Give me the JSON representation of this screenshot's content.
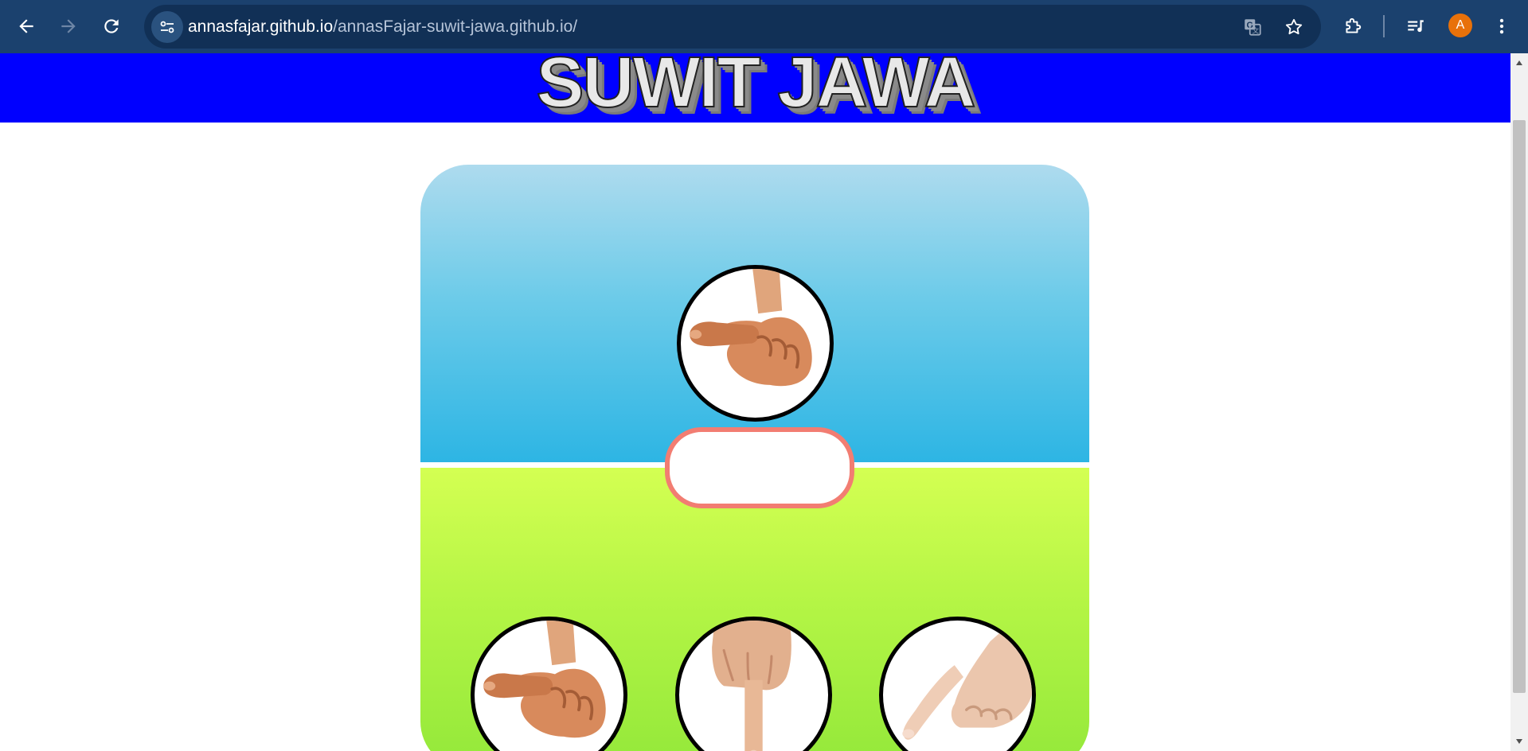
{
  "browser": {
    "url_host": "annasfajar.github.io",
    "url_path": "/annasFajar-suwit-jawa.github.io/",
    "profile_initial": "A",
    "icons": {
      "back": "arrow-left-icon",
      "forward": "arrow-right-icon",
      "reload": "reload-icon",
      "site_info": "tune-icon",
      "translate": "translate-icon",
      "bookmark": "star-icon",
      "extensions": "puzzle-icon",
      "media": "media-queue-icon",
      "menu": "kebab-menu-icon"
    },
    "colors": {
      "toolbar": "#1b416e",
      "omnibox": "#113056",
      "avatar": "#e8710a"
    }
  },
  "page": {
    "title": "SUWIT JAWA",
    "result_text": "",
    "colors": {
      "header": "#0000ff",
      "computer_zone": "#2db5e4",
      "player_zone": "#93e83a",
      "result_border": "#f27d72"
    },
    "computer_choice": "thumb",
    "player_choices": [
      {
        "name": "thumb"
      },
      {
        "name": "index-finger"
      },
      {
        "name": "little-finger"
      }
    ]
  }
}
